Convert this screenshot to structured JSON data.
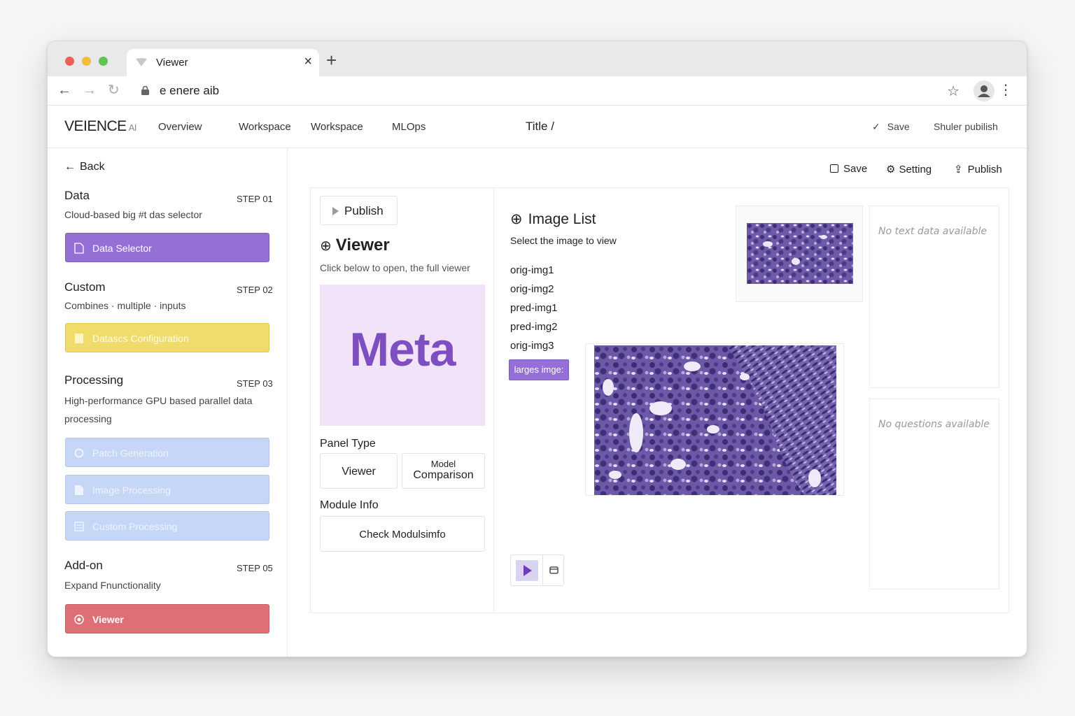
{
  "browser": {
    "tab_title": "Viewer",
    "url": "e  enere aib",
    "icons": {
      "back": "arrow-left-icon",
      "forward": "arrow-right-icon",
      "reload": "reload-icon",
      "star": "star-icon",
      "profile": "profile-icon",
      "menu": "kebab-icon"
    }
  },
  "header": {
    "logo": "VEIENCE",
    "logo_sub": "AI",
    "nav": [
      "Overview",
      "Workspace",
      "Workspace",
      "MLOps"
    ],
    "title": "Title /",
    "save": "Save",
    "publish": "Shuler pubilish"
  },
  "sidebar": {
    "back": "Back",
    "steps": [
      {
        "title": "Data",
        "step": "STEP 01",
        "desc": "Cloud-based big #t das selector"
      },
      {
        "title": "Custom",
        "step": "STEP 02",
        "desc": "Combines · multiple · inputs"
      },
      {
        "title": "Processing",
        "step": "STEP 03",
        "desc": "High-performance GPU based parallel data processing"
      },
      {
        "title": "Add-on",
        "step": "STEP 05",
        "desc": "Expand Fnunctionality"
      }
    ],
    "buttons": {
      "data_selector": "Data Selector",
      "dataset_config": "Datascs Configuration",
      "patch_generation": "Patch Generation",
      "image_processing": "Image Processing",
      "custom_processing": "Custom Processing",
      "viewer": "Viewer"
    },
    "colors": {
      "purple": "#9470d6",
      "yellow": "#f0dc6a",
      "blue": "#c6d6f7",
      "red": "#df6f76"
    }
  },
  "toolbar": {
    "save": "Save",
    "setting": "Setting",
    "publish": "Publish"
  },
  "viewer_panel": {
    "publish_button": "Publish",
    "title": "Viewer",
    "desc": "Click below to open, the full viewer",
    "meta_text": "Meta",
    "panel_type_label": "Panel Type",
    "panel_type_viewer": "Viewer",
    "panel_type_model_top": "Model",
    "panel_type_model_bottom": "Comparison",
    "module_info_label": "Module Info",
    "check_button": "Check Modulsimfo"
  },
  "image_list": {
    "title": "Image List",
    "subtitle": "Select the image to view",
    "items": [
      "orig-img1",
      "orig-img2",
      "pred-img1",
      "pred-img2",
      "orig-img3"
    ],
    "large_button": "larges imge:"
  },
  "side_panels": {
    "text": "No text data available",
    "questions": "No questions available"
  }
}
